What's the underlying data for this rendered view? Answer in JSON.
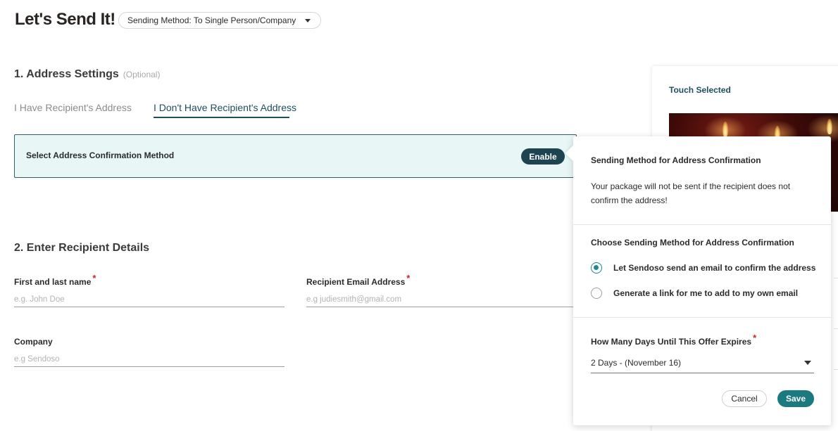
{
  "header": {
    "title": "Let's Send It!",
    "sending_method_label": "Sending Method: To Single Person/Company"
  },
  "address_settings": {
    "heading": "1. Address Settings",
    "optional": "(Optional)",
    "tabs": [
      {
        "label": "I Have Recipient's Address",
        "active": false
      },
      {
        "label": "I Don't Have Recipient's Address",
        "active": true
      }
    ],
    "confirm_label": "Select Address Confirmation Method",
    "enable_label": "Enable"
  },
  "recipient": {
    "heading": "2. Enter Recipient Details",
    "name_label": "First and last name",
    "name_placeholder": "e.g. John Doe",
    "email_label": "Recipient Email Address",
    "email_placeholder": "e.g judiesmith@gmail.com",
    "company_label": "Company",
    "company_placeholder": "e.g Sendoso",
    "required_mark": "*"
  },
  "side_panel": {
    "touch_label": "Touch Selected"
  },
  "popover": {
    "title": "Sending Method for Address Confirmation",
    "note": "Your package will not be sent if the recipient does not confirm the address!",
    "choose_label": "Choose Sending Method for Address Confirmation",
    "options": [
      {
        "label": "Let Sendoso send an email to confirm the address",
        "selected": true
      },
      {
        "label": "Generate a link for me to add to my own email",
        "selected": false
      }
    ],
    "expire_label": "How Many Days Until This Offer Expires",
    "expire_value": "2 Days - (November 16)",
    "cancel_label": "Cancel",
    "save_label": "Save"
  },
  "colors": {
    "primary_dark": "#1e4452",
    "accent_teal": "#1a7a80",
    "confirm_bg": "#e8f6f6",
    "required_red": "#c62828"
  }
}
